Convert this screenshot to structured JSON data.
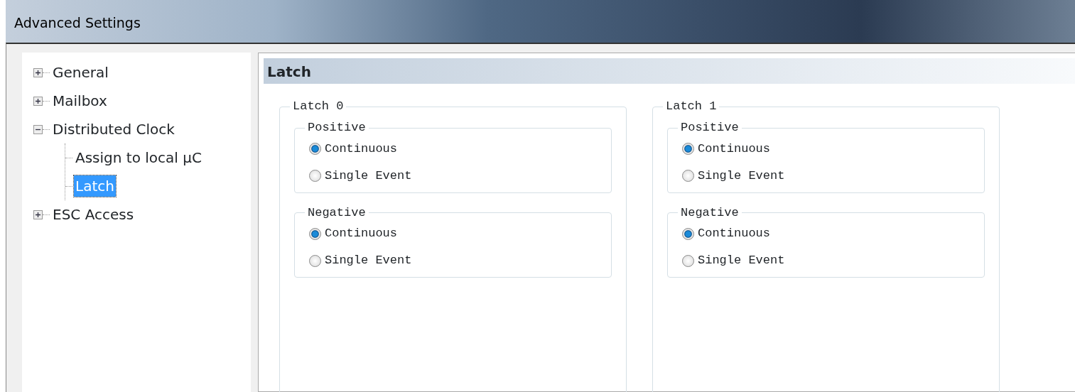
{
  "window": {
    "title": "Advanced Settings"
  },
  "tree": {
    "items": [
      {
        "label": "General",
        "expanded": false,
        "selected": false
      },
      {
        "label": "Mailbox",
        "expanded": false,
        "selected": false
      },
      {
        "label": "Distributed Clock",
        "expanded": true,
        "selected": false,
        "children": [
          {
            "label": "Assign to local µC",
            "selected": false
          },
          {
            "label": "Latch",
            "selected": true
          }
        ]
      },
      {
        "label": "ESC Access",
        "expanded": false,
        "selected": false
      }
    ]
  },
  "panel": {
    "title": "Latch"
  },
  "latches": [
    {
      "title": "Latch 0",
      "groups": [
        {
          "title": "Positive",
          "options": [
            {
              "label": "Continuous",
              "selected": true
            },
            {
              "label": "Single Event",
              "selected": false
            }
          ]
        },
        {
          "title": "Negative",
          "options": [
            {
              "label": "Continuous",
              "selected": true
            },
            {
              "label": "Single Event",
              "selected": false
            }
          ]
        }
      ]
    },
    {
      "title": "Latch 1",
      "groups": [
        {
          "title": "Positive",
          "options": [
            {
              "label": "Continuous",
              "selected": true
            },
            {
              "label": "Single Event",
              "selected": false
            }
          ]
        },
        {
          "title": "Negative",
          "options": [
            {
              "label": "Continuous",
              "selected": true
            },
            {
              "label": "Single Event",
              "selected": false
            }
          ]
        }
      ]
    }
  ]
}
